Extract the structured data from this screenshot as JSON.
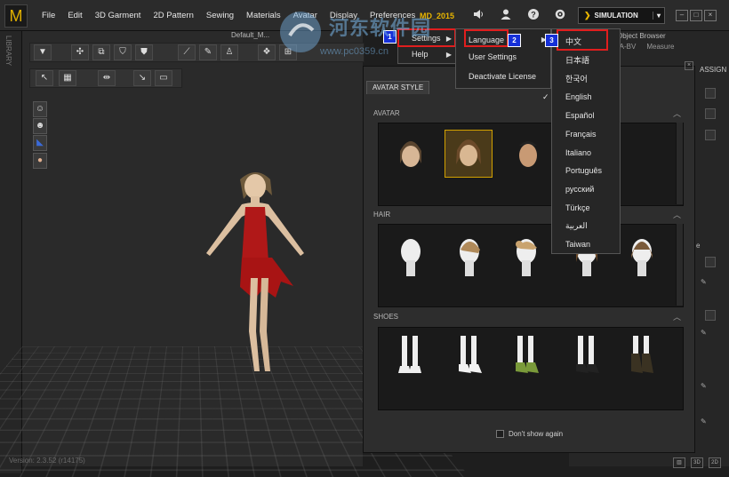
{
  "app": {
    "logo": "M",
    "brand": "MD_2015",
    "version": "Version: 2.3.52    (r14175)"
  },
  "menubar": [
    "File",
    "Edit",
    "3D Garment",
    "2D Pattern",
    "Sewing",
    "Materials",
    "Avatar",
    "Display",
    "Preferences"
  ],
  "toolbar_right": {
    "simulation": "SIMULATION",
    "icons": [
      "speaker-icon",
      "user-icon",
      "help-icon",
      "gear-icon"
    ]
  },
  "viewport": {
    "title": "Default_M...",
    "library_tab": "LIBRARY"
  },
  "object_browser": {
    "title": "Object Browser",
    "tabs": [
      "nt",
      "A-BV",
      "Measure"
    ],
    "assign_label": "ASSIGN",
    "partial_label": "e"
  },
  "avatar_panel": {
    "tab": "AVATAR STYLE",
    "sections": [
      {
        "title": "AVATAR",
        "items": [
          "female-avatar-1",
          "female-avatar-2",
          "male-avatar-1"
        ]
      },
      {
        "title": "HAIR",
        "items": [
          "hair-none",
          "hair-style-1",
          "hair-style-2",
          "hair-style-3",
          "hair-style-4"
        ]
      },
      {
        "title": "SHOES",
        "items": [
          "shoes-barefoot",
          "shoes-heels",
          "shoes-green",
          "shoes-strappy",
          "shoes-boots"
        ]
      }
    ],
    "dont_show_again": "Don't show again"
  },
  "menus": {
    "preferences": [
      {
        "label": "Settings",
        "has_submenu": true
      },
      {
        "label": "Help",
        "has_submenu": true
      }
    ],
    "settings": [
      "Language",
      "User Settings",
      "Deactivate License"
    ],
    "languages": [
      {
        "label": "中文"
      },
      {
        "label": "日本語"
      },
      {
        "label": "한국어"
      },
      {
        "label": "English",
        "checked": true
      },
      {
        "label": "Español"
      },
      {
        "label": "Français"
      },
      {
        "label": "Italiano"
      },
      {
        "label": "Português"
      },
      {
        "label": "русский"
      },
      {
        "label": "Türkçe"
      },
      {
        "label": "العربية"
      },
      {
        "label": "Taiwan"
      }
    ]
  },
  "annotations": {
    "step1": "1",
    "step2": "2",
    "step3": "3",
    "check_mark": "✓"
  },
  "watermark": {
    "text": "河东软件园",
    "url": "www.pc0359.cn"
  },
  "colors": {
    "accent": "#e8b500",
    "highlight_box": "#e01e1e",
    "badge": "#1630d8",
    "dress": "#b01818"
  }
}
